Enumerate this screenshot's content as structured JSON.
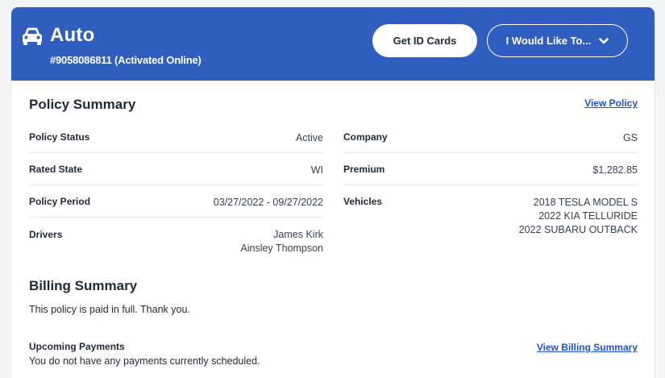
{
  "header": {
    "icon": "car-icon",
    "title": "Auto",
    "policy_number": "#9058086811 (Activated Online)",
    "get_id_cards_label": "Get ID Cards",
    "would_like_label": "I Would Like To...",
    "colors": {
      "header_bg": "#2f5ec0",
      "link": "#1d4ed8"
    }
  },
  "policy_summary": {
    "title": "Policy Summary",
    "view_policy_label": "View Policy",
    "left": [
      {
        "label": "Policy Status",
        "value": "Active"
      },
      {
        "label": "Rated State",
        "value": "WI"
      },
      {
        "label": "Policy Period",
        "value": "03/27/2022 - 09/27/2022"
      },
      {
        "label": "Drivers",
        "values": [
          "James Kirk",
          "Ainsley Thompson"
        ]
      }
    ],
    "right": [
      {
        "label": "Company",
        "value": "GS"
      },
      {
        "label": "Premium",
        "value": "$1,282.85"
      },
      {
        "label": "Vehicles",
        "values": [
          "2018 TESLA MODEL S",
          "2022 KIA TELLURIDE",
          "2022 SUBARU OUTBACK"
        ]
      }
    ]
  },
  "billing_summary": {
    "title": "Billing Summary",
    "message": "This policy is paid in full. Thank you.",
    "upcoming_title": "Upcoming Payments",
    "upcoming_message": "You do not have any payments currently scheduled.",
    "view_billing_label": "View Billing Summary"
  }
}
